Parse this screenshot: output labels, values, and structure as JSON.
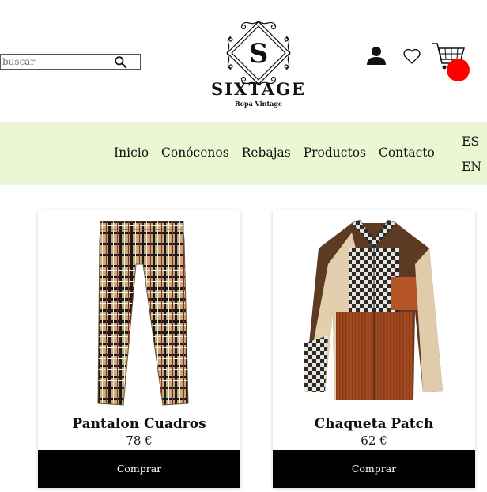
{
  "search": {
    "placeholder": "buscar",
    "value": "",
    "icon": "search-icon"
  },
  "brand": {
    "name": "SIXTAGE",
    "monogram": "S",
    "tagline": "Ropa Vintage"
  },
  "header_icons": [
    "user-icon",
    "heart-icon",
    "cart-icon"
  ],
  "cart": {
    "badge_color": "#ff0000"
  },
  "nav": {
    "bg_color": "#ebf7d2",
    "items": [
      {
        "label": "Inicio"
      },
      {
        "label": "Conócenos"
      },
      {
        "label": "Rebajas"
      },
      {
        "label": "Productos"
      },
      {
        "label": "Contacto"
      }
    ],
    "languages": [
      "ES",
      "EN"
    ]
  },
  "products": [
    {
      "name": "Pantalon Cuadros",
      "price": "78 €",
      "button": "Comprar"
    },
    {
      "name": "Chaqueta Patch",
      "price": "62 €",
      "button": "Comprar"
    }
  ]
}
